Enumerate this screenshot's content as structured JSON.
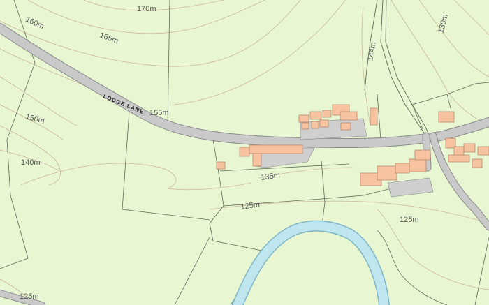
{
  "map": {
    "colors": {
      "land": "#e8f6d2",
      "river_fill": "#bfe6ee",
      "river_edge": "#7fb6c7",
      "road": "#c9c9c9",
      "building": "#f7c3a0",
      "contour": "#c9b79a",
      "boundary": "#5d6b57"
    },
    "road_name": "LODGE LANE",
    "contour_labels": [
      "170m",
      "160m",
      "165m",
      "155m",
      "150m",
      "140m",
      "144m",
      "130m",
      "135m",
      "125m",
      "125m",
      "125m"
    ]
  }
}
